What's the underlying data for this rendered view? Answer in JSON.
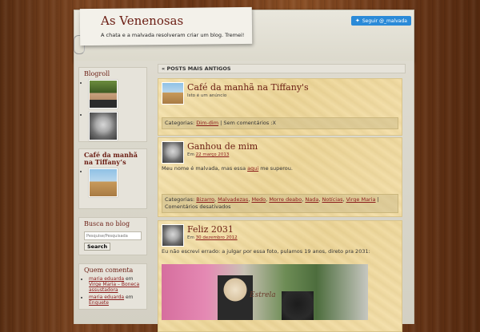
{
  "header": {
    "title": "As Venenosas",
    "tagline": "A chata e a malvada resolveram criar um blog. Tremei!",
    "follow_label": "Seguir @_malvada"
  },
  "sidebar": {
    "blogroll": {
      "title": "Blogroll"
    },
    "cafe": {
      "title": "Café da manhã na Tiffany’s"
    },
    "search": {
      "title": "Busca no blog",
      "placeholder": "Pesquise/Pesquisada",
      "button": "Search"
    },
    "comments": {
      "title": "Quem comenta",
      "items": [
        {
          "author": "maria eduarda",
          "sep": " em ",
          "target": "Virge Maria – Boneca assustadora"
        },
        {
          "author": "maria eduarda",
          "sep": " em ",
          "target": "Enquete"
        }
      ]
    }
  },
  "nav": {
    "older_posts": "« POSTS MAIS ANTIGOS"
  },
  "posts": [
    {
      "title": "Café da manhã na Tiffany's",
      "meta": "Isto é um anúncio",
      "cats_label": "Categorias:",
      "cats": [
        "Dim-dim"
      ],
      "after": " | Sem comentários :X"
    },
    {
      "title": "Ganhou de mim",
      "meta_prefix": "Em ",
      "date": "22 março 2013",
      "body_before": "Meu nome é malvada, mas essa ",
      "body_link": "aqui",
      "body_after": " me superou.",
      "cats_label": "Categorias:",
      "cats": [
        "Bizarro",
        "Malvadezas",
        "Medo",
        "Morre deabo",
        "Nada",
        "Notícias",
        "Virge Maria"
      ],
      "after": "Comentários desativados"
    },
    {
      "title": "Feliz 2031",
      "meta_prefix": "Em ",
      "date": "30 dezembro 2012",
      "body": "Eu não escrevi errado: a julgar por essa foto, pulamos 19 anos, direto pra 2031:",
      "photo_sign": "Estrela"
    }
  ],
  "colors": {
    "title": "#6a1c12",
    "link": "#8a1a1a",
    "twitter": "#2a8ad8",
    "paper": "#f1dca3"
  }
}
